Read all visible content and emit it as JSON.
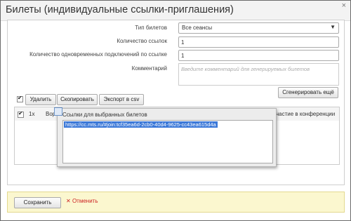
{
  "dialog": {
    "title": "Билеты (индивидуальные ссылки-приглашения)",
    "close": "×"
  },
  "form": {
    "ticket_type_label": "Тип билетов",
    "ticket_type_value": "Все сеансы",
    "link_count_label": "Количество ссылок",
    "link_count_value": "1",
    "connections_label": "Количество одновременных подключений по ссылке",
    "connections_value": "1",
    "comment_label": "Комментарий",
    "comment_placeholder": "Введите комментарий для генерируемых билетов"
  },
  "buttons": {
    "generate": "Сгенерировать ещё",
    "delete": "Удалить",
    "copy": "Скопировать",
    "export": "Экспорт в csv"
  },
  "grid": {
    "col_count": "1x",
    "col_partial": "Вор",
    "col_right": "частие в конференции"
  },
  "popup": {
    "title": "Ссылки для выбранных билетов",
    "link": "https://cc.mts.ru/#join:tcf35ea6d-2cb0-40d4-9625-cc43ea615d4a"
  },
  "footer": {
    "save": "Сохранить",
    "cancel": "Отменить",
    "cancel_icon": "✕"
  }
}
